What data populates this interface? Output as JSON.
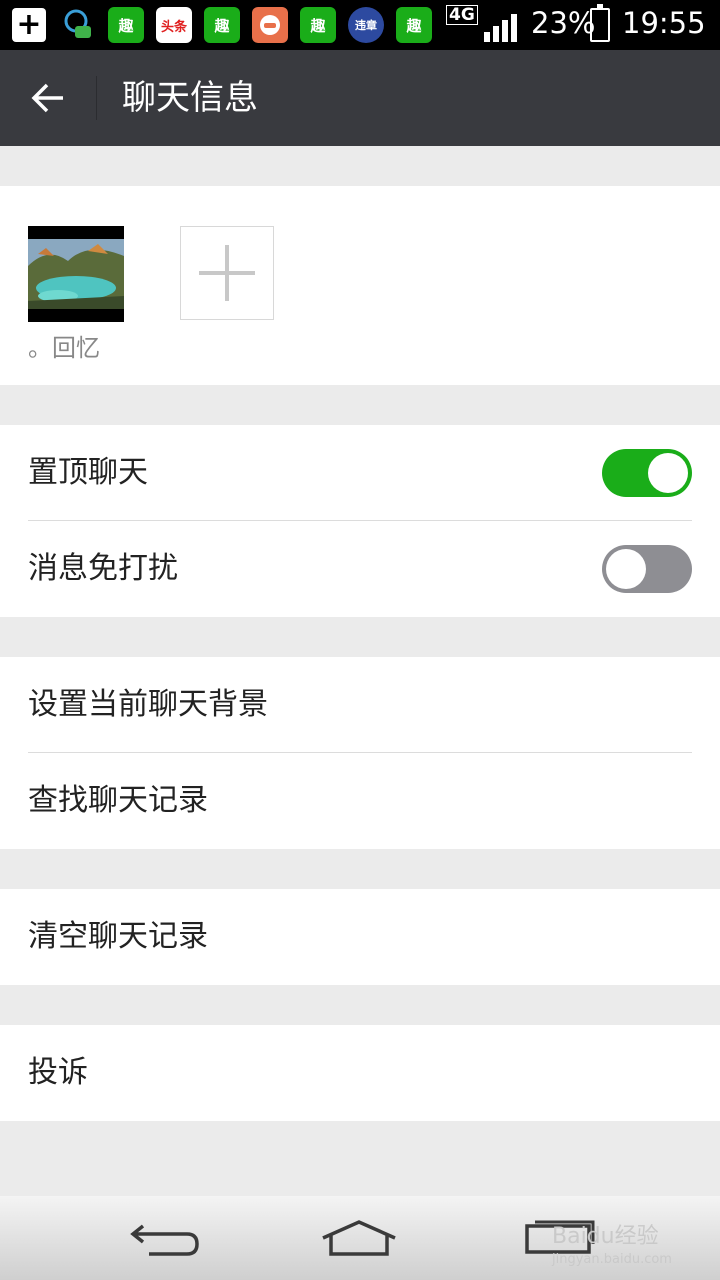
{
  "status_bar": {
    "network": "4G",
    "battery": "23%",
    "time": "19:55",
    "app_icons": [
      {
        "icon": "plus-icon"
      },
      {
        "icon": "qq-chat-icon"
      },
      {
        "icon": "qu-app-icon",
        "label": "趣"
      },
      {
        "icon": "toutiao-icon",
        "label": "头条"
      },
      {
        "icon": "qu-app-icon",
        "label": "趣"
      },
      {
        "icon": "car-app-icon"
      },
      {
        "icon": "qu-app-icon",
        "label": "趣"
      },
      {
        "icon": "traffic-app-icon",
        "label": "违章"
      },
      {
        "icon": "qu-app-icon",
        "label": "趣"
      }
    ]
  },
  "title_bar": {
    "title": "聊天信息",
    "back_icon": "arrow-left-icon"
  },
  "members": {
    "list": [
      {
        "name": "。回忆",
        "avatar": "landscape-photo"
      }
    ],
    "add_icon": "plus-icon"
  },
  "settings": {
    "pin_chat": {
      "label": "置顶聊天",
      "enabled": true
    },
    "mute": {
      "label": "消息免打扰",
      "enabled": false
    },
    "set_background": {
      "label": "设置当前聊天背景"
    },
    "search_history": {
      "label": "查找聊天记录"
    },
    "clear_history": {
      "label": "清空聊天记录"
    },
    "report": {
      "label": "投诉"
    }
  },
  "nav_bar": {
    "back_icon": "nav-back-icon",
    "home_icon": "nav-home-icon",
    "recents_icon": "nav-recents-icon"
  },
  "watermark": {
    "brand": "Baidu经验",
    "url": "jingyan.baidu.com"
  },
  "colors": {
    "accent": "#1aad19",
    "title_bar": "#393a3f",
    "background": "#ebebeb"
  }
}
